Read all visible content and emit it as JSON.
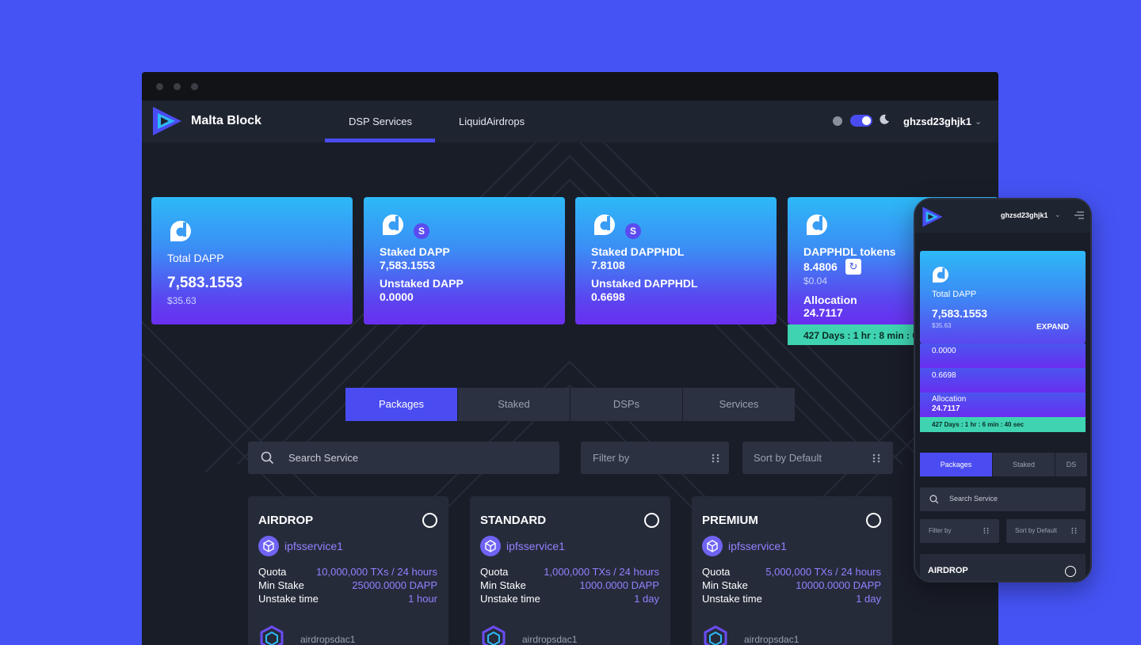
{
  "app": {
    "brand": "Malta Block"
  },
  "nav": {
    "links": [
      "DSP Services",
      "LiquidAirdrops"
    ],
    "user": "ghzsd23ghjk1"
  },
  "colors": {
    "background": "#4553f5",
    "accent": "#4a4cf2",
    "timer": "#3fd3b1",
    "link": "#8f82ff"
  },
  "icons": {
    "logo": "malta-block-logo-icon",
    "token": "dapp-token-icon",
    "staked": "staked-s-badge-icon",
    "refresh": "refresh-icon",
    "search": "search-icon",
    "grip": "grip-icon",
    "package": "cube-icon"
  },
  "cards": {
    "total": {
      "title": "Total DAPP",
      "value": "7,583.1553",
      "usd": "$35.63"
    },
    "dapp": {
      "badge": "S",
      "staked_label": "Staked DAPP",
      "staked_value": "7,583.1553",
      "unstaked_label": "Unstaked DAPP",
      "unstaked_value": "0.0000"
    },
    "dapphdl": {
      "badge": "S",
      "staked_label": "Staked DAPPHDL",
      "staked_value": "7.8108",
      "unstaked_label": "Unstaked DAPPHDL",
      "unstaked_value": "0.6698"
    },
    "tokens": {
      "title": "DAPPHDL tokens",
      "value": "8.4806",
      "usd": "$0.04",
      "alloc_label": "Allocation",
      "alloc_value": "24.7117",
      "timer": "427 Days : 1 hr : 8 min : 0"
    }
  },
  "tabs": [
    "Packages",
    "Staked",
    "DSPs",
    "Services"
  ],
  "filters": {
    "search_placeholder": "Search Service",
    "filter_placeholder": "Filter by",
    "sort_placeholder": "Sort by Default"
  },
  "packages": [
    {
      "title": "AIRDROP",
      "service": "ipfsservice1",
      "quota_label": "Quota",
      "quota": "10,000,000 TXs / 24 hours",
      "stake_label": "Min Stake",
      "stake": "25000.0000 DAPP",
      "unstake_label": "Unstake time",
      "unstake": "1 hour",
      "owner": "airdropsdac1"
    },
    {
      "title": "STANDARD",
      "service": "ipfsservice1",
      "quota_label": "Quota",
      "quota": "1,000,000 TXs / 24 hours",
      "stake_label": "Min Stake",
      "stake": "1000.0000 DAPP",
      "unstake_label": "Unstake time",
      "unstake": "1 day",
      "owner": "airdropsdac1"
    },
    {
      "title": "PREMIUM",
      "service": "ipfsservice1",
      "quota_label": "Quota",
      "quota": "5,000,000 TXs / 24 hours",
      "stake_label": "Min Stake",
      "stake": "10000.0000 DAPP",
      "unstake_label": "Unstake time",
      "unstake": "1 day",
      "owner": "airdropsdac1"
    }
  ],
  "mobile": {
    "user": "ghzsd23ghjk1",
    "card": {
      "title": "Total DAPP",
      "value": "7,583.1553",
      "usd": "$35.63",
      "expand": "EXPAND"
    },
    "strips": [
      "0.0000",
      "0.6698"
    ],
    "alloc_label": "Allocation",
    "alloc_value": "24.7117",
    "timer": "427 Days : 1 hr : 6 min : 40 sec",
    "tabs": [
      "Packages",
      "Staked",
      "DS"
    ],
    "search_placeholder": "Search Service",
    "filter_placeholder": "Filter by",
    "sort_placeholder": "Sort by Default",
    "package_title": "AIRDROP"
  }
}
